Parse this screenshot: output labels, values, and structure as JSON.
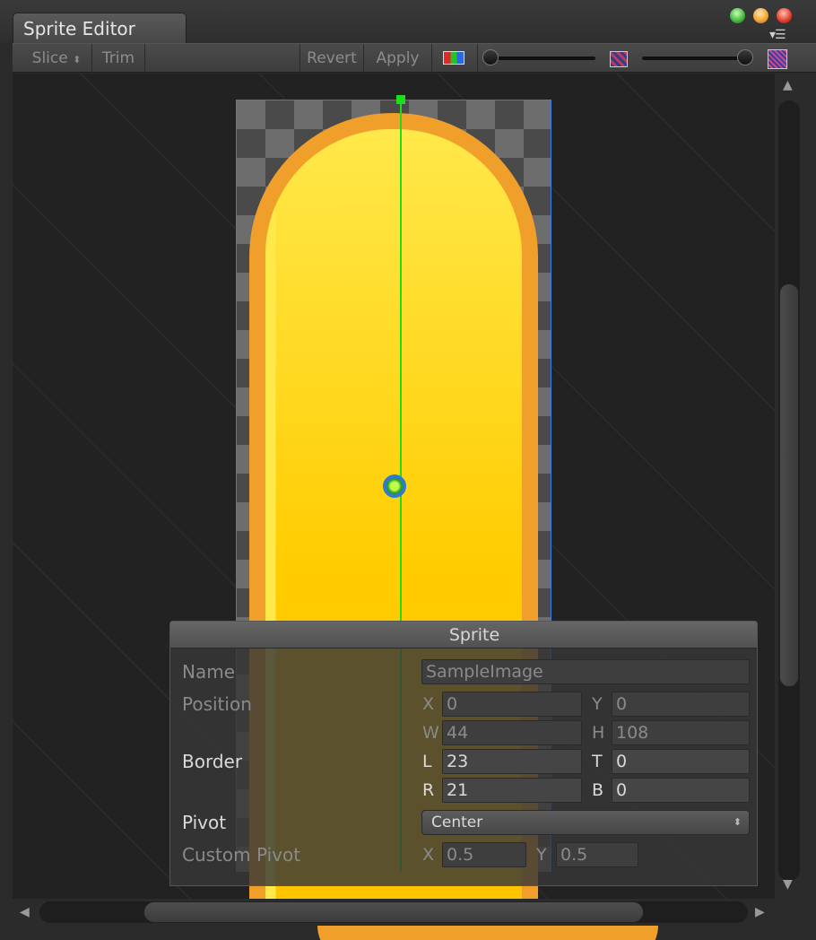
{
  "window": {
    "tab_title": "Sprite Editor",
    "menu_icon": "menu-list-icon"
  },
  "toolbar": {
    "slice": "Slice",
    "slice_chevron": "⬍",
    "trim": "Trim",
    "revert": "Revert",
    "apply": "Apply",
    "color_channel_icon": "rgb-channel-icon",
    "zoom_slider": 0.0,
    "mip_icon": "mipmap-small-icon",
    "mip_slider": 1.0,
    "mip_large_icon": "mipmap-large-icon"
  },
  "sprite_panel": {
    "title": "Sprite",
    "name_label": "Name",
    "name_value": "SampleImage",
    "position_label": "Position",
    "x_axis": "X",
    "x_value": "0",
    "y_axis": "Y",
    "y_value": "0",
    "w_axis": "W",
    "w_value": "44",
    "h_axis": "H",
    "h_value": "108",
    "border_label": "Border",
    "l_axis": "L",
    "l_value": "23",
    "t_axis": "T",
    "t_value": "0",
    "r_axis": "R",
    "r_value": "21",
    "b_axis": "B",
    "b_value": "0",
    "pivot_label": "Pivot",
    "pivot_value": "Center",
    "custom_pivot_label": "Custom Pivot",
    "cx_axis": "X",
    "cx_value": "0.5",
    "cy_axis": "Y",
    "cy_value": "0.5"
  },
  "colors": {
    "pivot_line": "#19e019",
    "sprite_outline": "#3a7ce0",
    "sprite_fill": "#ffcc00",
    "sprite_edge": "#f0a02a"
  }
}
